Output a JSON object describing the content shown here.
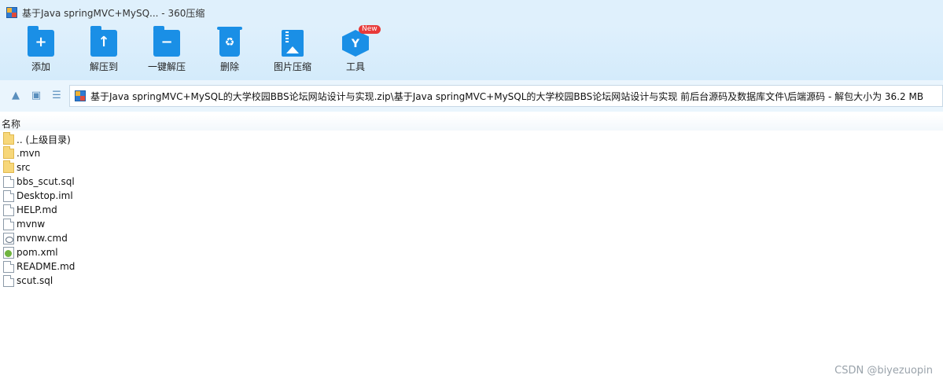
{
  "window": {
    "title": "基于Java springMVC+MySQ... - 360压缩"
  },
  "toolbar": {
    "items": [
      {
        "label": "添加",
        "icon": "add-icon"
      },
      {
        "label": "解压到",
        "icon": "extract-to-icon"
      },
      {
        "label": "一键解压",
        "icon": "one-click-extract-icon"
      },
      {
        "label": "删除",
        "icon": "delete-icon"
      },
      {
        "label": "图片压缩",
        "icon": "image-compress-icon"
      },
      {
        "label": "工具",
        "icon": "tools-icon",
        "badge": "New"
      }
    ]
  },
  "address": {
    "path": "基于Java springMVC+MySQL的大学校园BBS论坛网站设计与实现.zip\\基于Java springMVC+MySQL的大学校园BBS论坛网站设计与实现 前后台源码及数据库文件\\后端源码 - 解包大小为 36.2 MB"
  },
  "list": {
    "column_name": "名称",
    "files": [
      {
        "name": ".. (上级目录)",
        "type": "folder"
      },
      {
        "name": ".mvn",
        "type": "folder"
      },
      {
        "name": "src",
        "type": "folder"
      },
      {
        "name": "bbs_scut.sql",
        "type": "file"
      },
      {
        "name": "Desktop.iml",
        "type": "file"
      },
      {
        "name": "HELP.md",
        "type": "file"
      },
      {
        "name": "mvnw",
        "type": "file"
      },
      {
        "name": "mvnw.cmd",
        "type": "cmd"
      },
      {
        "name": "pom.xml",
        "type": "xml"
      },
      {
        "name": "README.md",
        "type": "file"
      },
      {
        "name": "scut.sql",
        "type": "file"
      }
    ]
  },
  "watermark": "CSDN @biyezuopin",
  "colors": {
    "toolbar_bg": "#dff0fc",
    "icon_blue": "#1a8fe6",
    "badge_red": "#e83a3a"
  }
}
